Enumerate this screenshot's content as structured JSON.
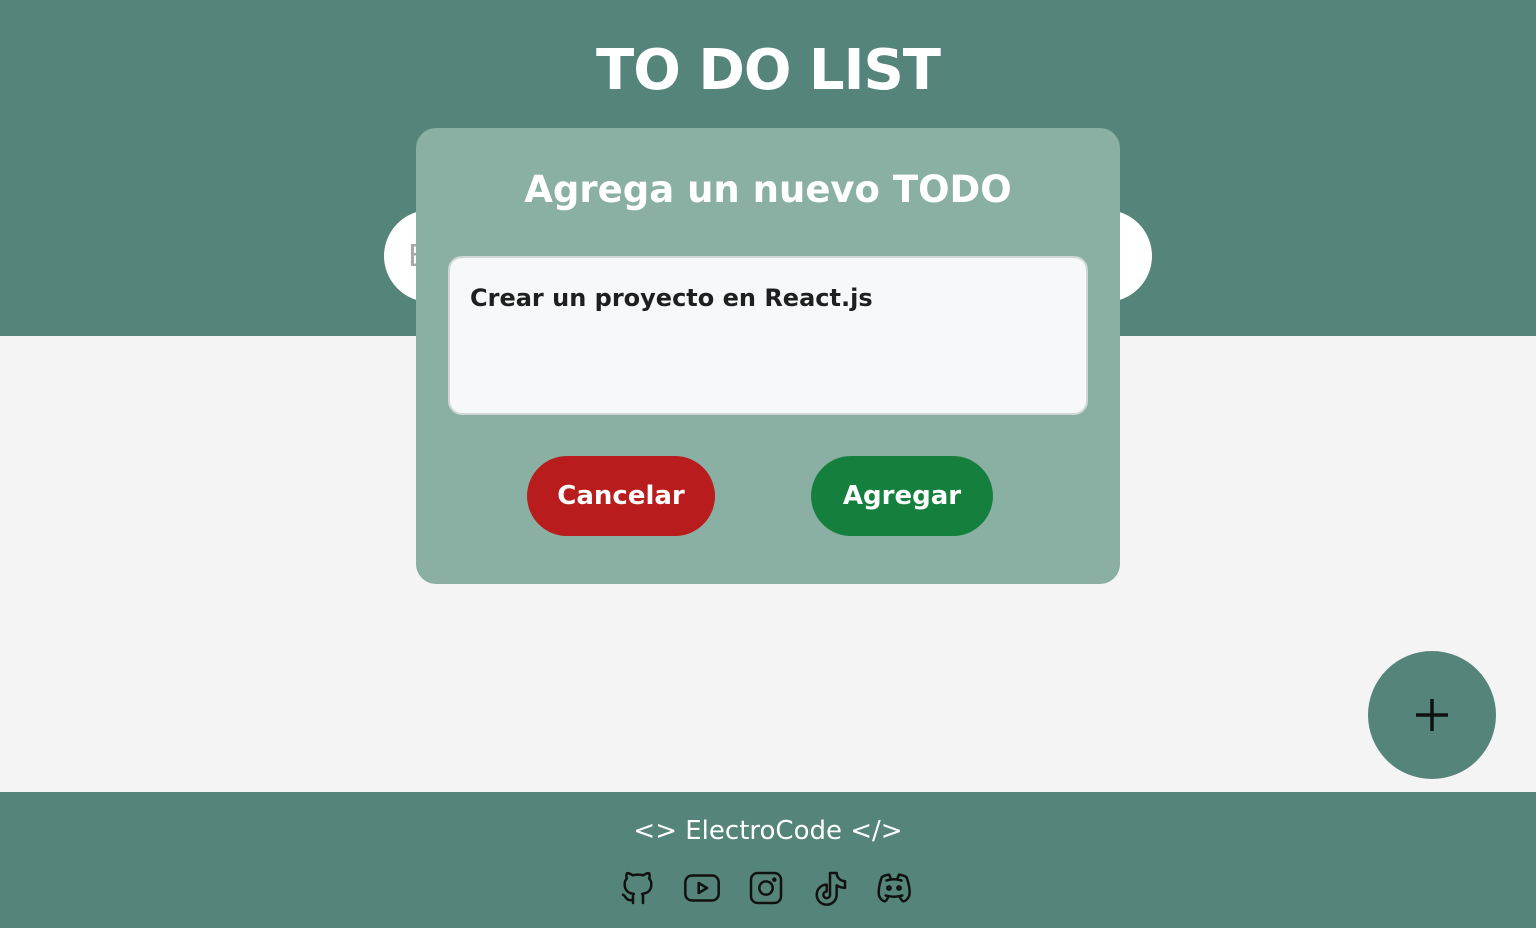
{
  "header": {
    "title": "TO DO LIST",
    "search_placeholder_visible": "E"
  },
  "modal": {
    "title": "Agrega un nuevo TODO",
    "textarea_value": "Crear un proyecto en React.js",
    "cancel_label": "Cancelar",
    "add_label": "Agregar"
  },
  "fab": {
    "icon": "plus-icon"
  },
  "footer": {
    "brand": "<> ElectroCode </>",
    "social_icons": [
      "github-icon",
      "youtube-icon",
      "instagram-icon",
      "tiktok-icon",
      "discord-icon"
    ]
  },
  "colors": {
    "primary": "#55857a",
    "modal_bg": "#89b0a2",
    "cancel": "#b91c1c",
    "add": "#15803d",
    "background": "#f4f4f4"
  }
}
